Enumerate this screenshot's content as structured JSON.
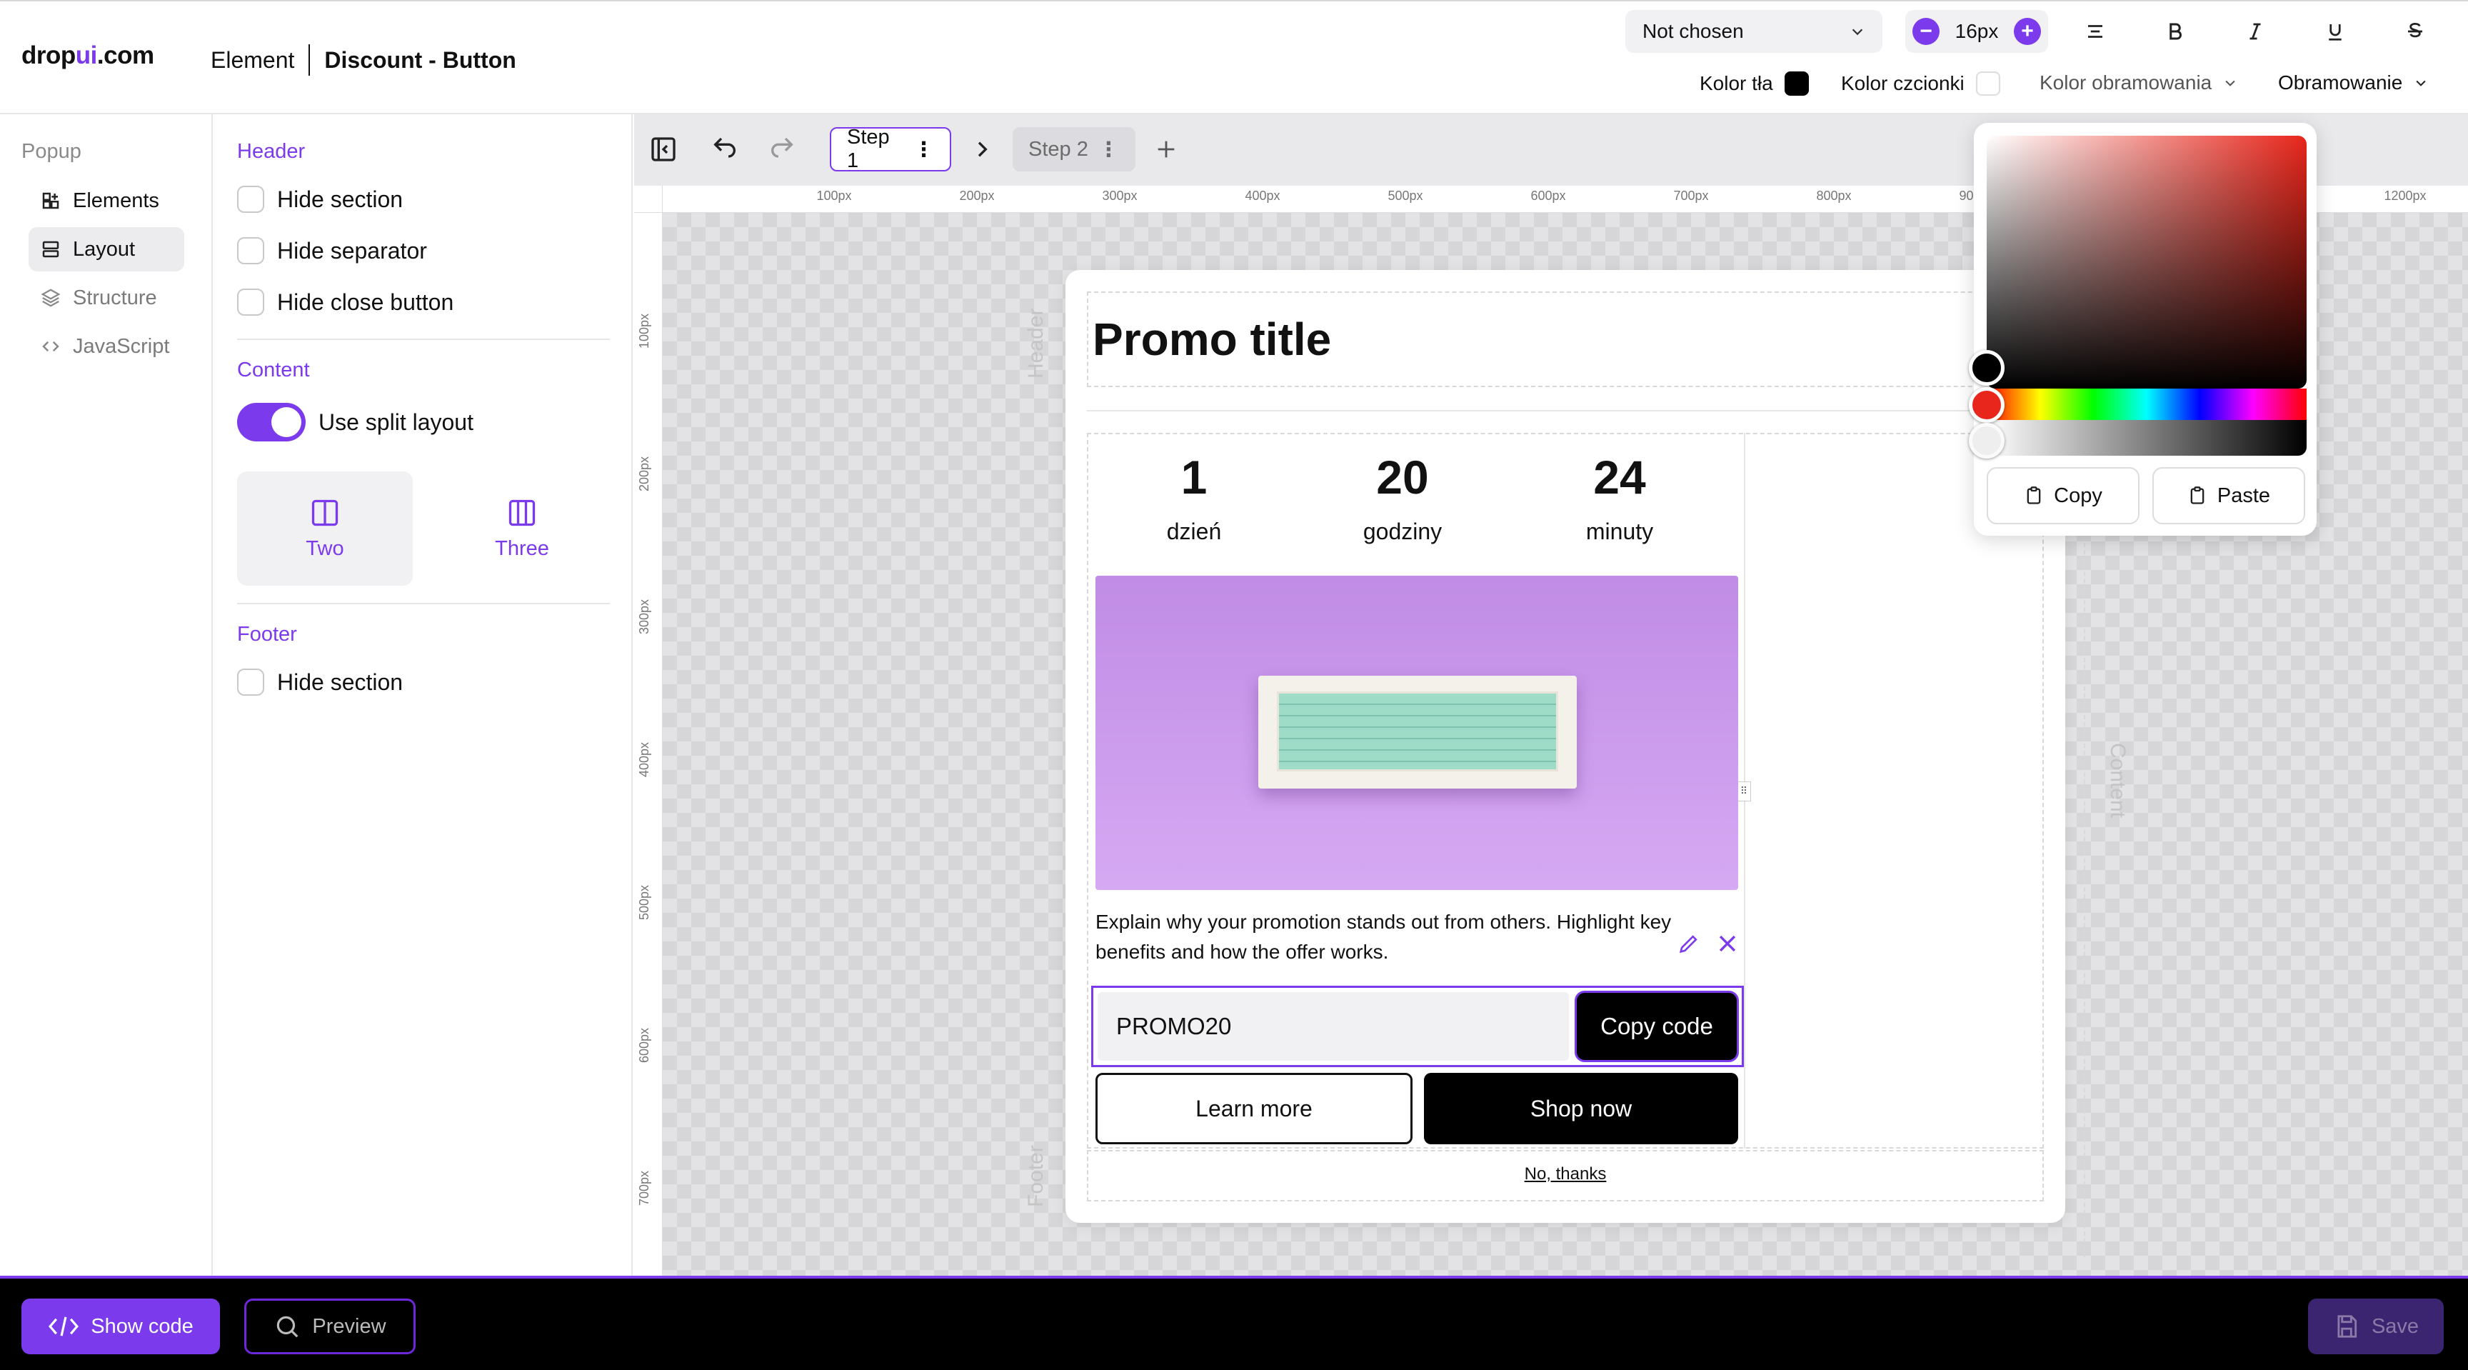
{
  "header": {
    "logo_prefix": "drop",
    "logo_accent": "ui",
    "logo_suffix": ".com",
    "crumb_element": "Element",
    "crumb_name": "Discount - Button"
  },
  "toolbar": {
    "font_select": "Not chosen",
    "font_size": "16px",
    "bg_color_label": "Kolor tła",
    "bg_color_value": "#000000",
    "font_color_label": "Kolor czcionki",
    "font_color_value": "#ffffff",
    "border_color_label": "Kolor obramowania",
    "border_label": "Obramowanie"
  },
  "sidebar": {
    "title": "Popup",
    "items": [
      {
        "label": "Elements",
        "icon": "elements-icon",
        "active": false
      },
      {
        "label": "Layout",
        "icon": "layout-icon",
        "active": true
      },
      {
        "label": "Structure",
        "icon": "layers-icon",
        "active": false
      },
      {
        "label": "JavaScript",
        "icon": "code-icon",
        "active": false
      }
    ]
  },
  "panel": {
    "header_title": "Header",
    "header_options": [
      "Hide section",
      "Hide separator",
      "Hide close button"
    ],
    "content_title": "Content",
    "split_label": "Use split layout",
    "split_on": true,
    "layouts": [
      {
        "label": "Two",
        "selected": true
      },
      {
        "label": "Three",
        "selected": false
      }
    ],
    "footer_title": "Footer",
    "footer_options": [
      "Hide section"
    ]
  },
  "steps": {
    "step1": "Step 1",
    "step2": "Step 2"
  },
  "ruler": {
    "h": [
      "100px",
      "200px",
      "300px",
      "400px",
      "500px",
      "600px",
      "700px",
      "800px",
      "900px",
      "1200px"
    ],
    "v": [
      "100px",
      "200px",
      "300px",
      "400px",
      "500px",
      "600px",
      "700px"
    ]
  },
  "popup": {
    "title": "Promo title",
    "header_label": "Header",
    "content_label": "Content",
    "footer_label": "Footer",
    "countdown": [
      {
        "value": "1",
        "unit": "dzień"
      },
      {
        "value": "20",
        "unit": "godziny"
      },
      {
        "value": "24",
        "unit": "minuty"
      }
    ],
    "description": "Explain why your promotion stands out from others. Highlight key benefits and how the offer works.",
    "promo_code": "PROMO20",
    "copy_code": "Copy code",
    "learn_more": "Learn more",
    "shop_now": "Shop now",
    "no_thanks": "No, thanks"
  },
  "picker": {
    "copy": "Copy",
    "paste": "Paste",
    "hue_color": "#e8261b"
  },
  "bottom": {
    "show_code": "Show code",
    "preview": "Preview",
    "save": "Save"
  },
  "colors": {
    "accent": "#7c3aed"
  }
}
